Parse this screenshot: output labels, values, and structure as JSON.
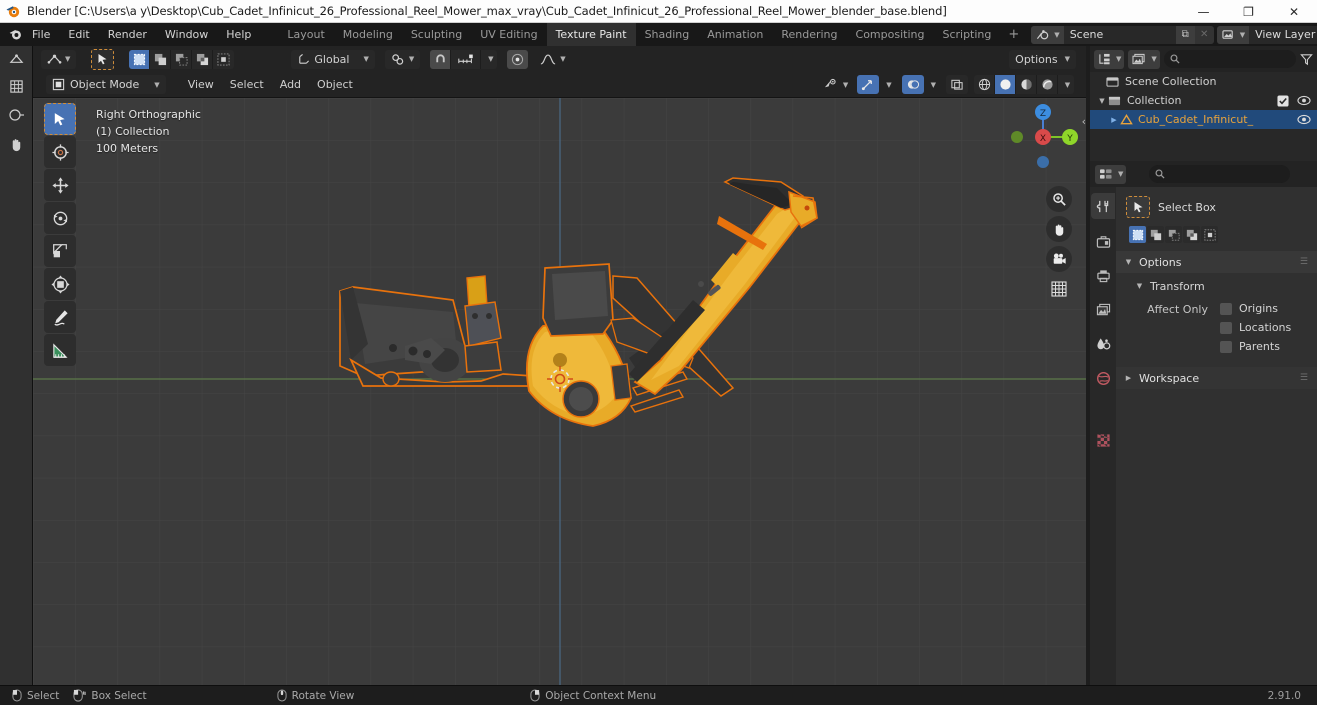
{
  "window": {
    "app_name": "Blender",
    "title": "Blender [C:\\Users\\a y\\Desktop\\Cub_Cadet_Infinicut_26_Professional_Reel_Mower_max_vray\\Cub_Cadet_Infinicut_26_Professional_Reel_Mower_blender_base.blend]",
    "minimize": "—",
    "maximize": "❐",
    "close": "✕"
  },
  "menubar": {
    "items": [
      "File",
      "Edit",
      "Render",
      "Window",
      "Help"
    ]
  },
  "workspace_tabs": {
    "tabs": [
      "Layout",
      "Modeling",
      "Sculpting",
      "UV Editing",
      "Texture Paint",
      "Shading",
      "Animation",
      "Rendering",
      "Compositing",
      "Scripting"
    ],
    "active": "Texture Paint",
    "add_label": "+"
  },
  "scene_selector": {
    "scene_name": "Scene",
    "view_layer_name": "View Layer",
    "new_label": "⧉",
    "unlink_label": "✕"
  },
  "viewport_header": {
    "editor_type": "editor-type-3d-viewport",
    "transform_orientation": "Global",
    "options_label": "Options",
    "mode": "Object Mode",
    "menus": [
      "View",
      "Select",
      "Add",
      "Object"
    ]
  },
  "viewport_overlay": {
    "view_name": "Right Orthographic",
    "collection": "(1) Collection",
    "scale": "100 Meters"
  },
  "viewport_tools": [
    {
      "name": "tweak-select-box-tool",
      "active": true
    },
    {
      "name": "cursor-tool",
      "active": false
    },
    {
      "name": "move-tool",
      "active": false
    },
    {
      "name": "rotate-tool",
      "active": false
    },
    {
      "name": "scale-tool",
      "active": false
    },
    {
      "name": "transform-tool",
      "active": false
    },
    {
      "name": "annotate-tool",
      "active": false
    },
    {
      "name": "measure-tool",
      "active": false
    }
  ],
  "gizmo": {
    "axis_z": "Z",
    "axis_x": "X",
    "axis_y": "Y"
  },
  "outliner": {
    "search_placeholder": "",
    "rows": [
      {
        "label": "Scene Collection",
        "indent": 0,
        "selected": false,
        "has_disclosure": false,
        "checkbox": false,
        "eye": false
      },
      {
        "label": "Collection",
        "indent": 1,
        "selected": false,
        "has_disclosure": true,
        "checkbox": true,
        "eye": true
      },
      {
        "label": "Cub_Cadet_Infinicut_",
        "indent": 2,
        "selected": true,
        "has_disclosure": true,
        "checkbox": false,
        "eye": true
      }
    ]
  },
  "properties": {
    "search_placeholder": "",
    "tool_name": "Select Box",
    "panels": {
      "options": "Options",
      "transform": "Transform",
      "affect_only_label": "Affect Only",
      "checkboxes": [
        "Origins",
        "Locations",
        "Parents"
      ],
      "workspace": "Workspace"
    },
    "tabs": [
      "tool-tab",
      "render-tab",
      "output-tab",
      "view-layer-tab",
      "scene-tab",
      "world-tab",
      "texture-tab"
    ]
  },
  "statusbar": {
    "items": [
      {
        "label": "Select",
        "icon": "mouse-left-icon"
      },
      {
        "label": "Box Select",
        "icon": "mouse-left-drag-icon"
      },
      {
        "label": "Rotate View",
        "icon": "mouse-middle-icon"
      },
      {
        "label": "Object Context Menu",
        "icon": "mouse-right-icon"
      }
    ],
    "version": "2.91.0"
  },
  "colors": {
    "accent_blue": "#4772b3",
    "select_orange": "#e8a33c",
    "viewport_bg": "#3b3b3b",
    "model_yellow": "#e8ab28",
    "model_dark": "#3a3a3a"
  }
}
